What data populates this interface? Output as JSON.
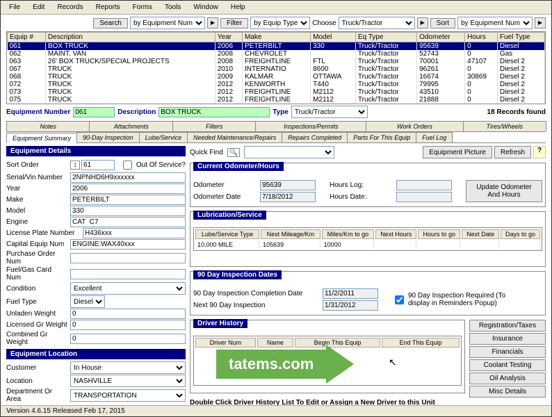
{
  "menu": [
    "File",
    "Edit",
    "Records",
    "Reports",
    "Forms",
    "Tools",
    "Window",
    "Help"
  ],
  "filterbar": {
    "search": "Search",
    "search_by": "by Equipment Num",
    "filter": "Filter",
    "filter_by": "by Equip Type",
    "choose": "Choose",
    "choose_val": "Truck/Tractor",
    "sort": "Sort",
    "sort_by": "by Equipment Num"
  },
  "grid": {
    "cols": [
      "Equip #",
      "Description",
      "Year",
      "Make",
      "Model",
      "Eq Type",
      "Odometer",
      "Hours",
      "Fuel Type"
    ],
    "rows": [
      [
        "061",
        "BOX TRUCK",
        "2006",
        "PETERBILT",
        "330",
        "Truck/Tractor",
        "95639",
        "0",
        "Diesel"
      ],
      [
        "062",
        "MAINT. VAN",
        "2008",
        "CHEVROLET",
        "",
        "Truck/Tractor",
        "52743",
        "0",
        "Gas"
      ],
      [
        "063",
        "26' BOX TRUCK/SPECIAL PROJECTS",
        "2008",
        "FREIGHTLINE",
        "FTL",
        "Truck/Tractor",
        "70001",
        "47107",
        "Diesel 2"
      ],
      [
        "067",
        "TRUCK",
        "2010",
        "INTERNATIO",
        "8600",
        "Truck/Tractor",
        "96261",
        "0",
        "Diesel 2"
      ],
      [
        "068",
        "TRUCK",
        "2009",
        "KALMAR",
        "OTTAWA",
        "Truck/Tractor",
        "16674",
        "30869",
        "Diesel 2"
      ],
      [
        "072",
        "TRUCK",
        "2012",
        "KENWORTH",
        "T440",
        "Truck/Tractor",
        "79995",
        "0",
        "Diesel 2"
      ],
      [
        "073",
        "TRUCK",
        "2012",
        "FREIGHTLINE",
        "M2112",
        "Truck/Tractor",
        "43510",
        "0",
        "Diesel 2"
      ],
      [
        "075",
        "TRUCK",
        "2012",
        "FREIGHTLINE",
        "M2112",
        "Truck/Tractor",
        "21888",
        "0",
        "Diesel 2"
      ]
    ],
    "selected": 0
  },
  "info": {
    "equip_num_label": "Equipment Number",
    "equip_num": "061",
    "desc_label": "Description",
    "desc": "BOX TRUCK",
    "type_label": "Type",
    "type": "Truck/Tractor",
    "records_found": "18 Records found"
  },
  "tabs1": [
    "Notes",
    "Attachments",
    "Filters",
    "Inspections/Permits",
    "Work Orders",
    "Tires/Wheels"
  ],
  "tabs2": [
    "Equipment Summary",
    "90-Day Inspection",
    "Lube/Service",
    "Needed Maintenance/Repairs",
    "Repairs Completed",
    "Parts For This Equip",
    "Fuel Log"
  ],
  "tabs2_active": 0,
  "details": {
    "hdr": "Equipment Details",
    "sort_order_label": "Sort Order",
    "sort_order": "61",
    "out_of_service": "Out Of Service?",
    "vin_label": "Serial/Vin Number",
    "vin": "2NPNHD6H9xxxxxx",
    "year_label": "Year",
    "year": "2006",
    "make_label": "Make",
    "make": "PETERBILT",
    "model_label": "Model",
    "model": "330",
    "engine_label": "Engine",
    "engine": "CAT  C7",
    "plate_label": "License Plate Number",
    "plate": "H436xxx",
    "capequip_label": "Capital Equip Num",
    "capequip": "ENGINE:WAX40xxx",
    "po_label": "Purchase Order Num",
    "po": "",
    "fuelcard_label": "Fuel/Gas Card Num",
    "fuelcard": "",
    "cond_label": "Condition",
    "cond": "Excellent",
    "fueltype_label": "Fuel Type",
    "fueltype": "Diesel",
    "unladen_label": "Unladen Weight",
    "unladen": "0",
    "licgr_label": "Licensed Gr Weight",
    "licgr": "0",
    "combgr_label": "Combined Gr Weight",
    "combgr": "0"
  },
  "location": {
    "hdr": "Equipment Location",
    "customer_label": "Customer",
    "customer": "In House",
    "loc_label": "Location",
    "loc": "NASHVILLE",
    "dept_label": "Department Or Area",
    "dept": "TRANSPORTATION"
  },
  "quickfind": {
    "label": "Quick Find",
    "equip_pic": "Equipment Picture",
    "refresh": "Refresh"
  },
  "odometer": {
    "hdr": "Current Odometer/Hours",
    "odo_label": "Odometer",
    "odo": "95639",
    "ododate_label": "Odometer Date",
    "ododate": "7/18/2012",
    "hourslog_label": "Hours Log:",
    "hoursdate_label": "Hours Date:",
    "update_btn": "Update Odometer And  Hours"
  },
  "lube": {
    "hdr": "Lubrication/Service",
    "cols": [
      "Lube/Service Type",
      "Next Mileage/Km",
      "Miles/Km to go",
      "Next Hours",
      "Hours to go",
      "Next Date",
      "Days to go"
    ],
    "rows": [
      [
        "10,000 MILE",
        "105639",
        "10000",
        "",
        "",
        "",
        ""
      ]
    ]
  },
  "ninety": {
    "hdr": "90 Day Inspection Dates",
    "comp_label": "90 Day Inspection Completion Date",
    "comp": "11/2/2011",
    "next_label": "Next 90 Day Inspection",
    "next": "1/31/2012",
    "req_label": "90 Day Inspection Required (To display in Reminders Popup)"
  },
  "driver": {
    "hdr": "Driver History",
    "cols": [
      "Driver Num",
      "Name",
      "Begin This Equip",
      "End This Equip"
    ],
    "hint": "Double Click Driver History List To Edit or Assign a New Driver to this Unit"
  },
  "sidebtns": [
    "Registration/Taxes",
    "Insurance",
    "Financials",
    "Coolant Testing",
    "Oil Analysis",
    "Misc Details"
  ],
  "watermark": "tatems.com",
  "statusbar": "Version 4.6.15 Released Feb 17, 2015"
}
